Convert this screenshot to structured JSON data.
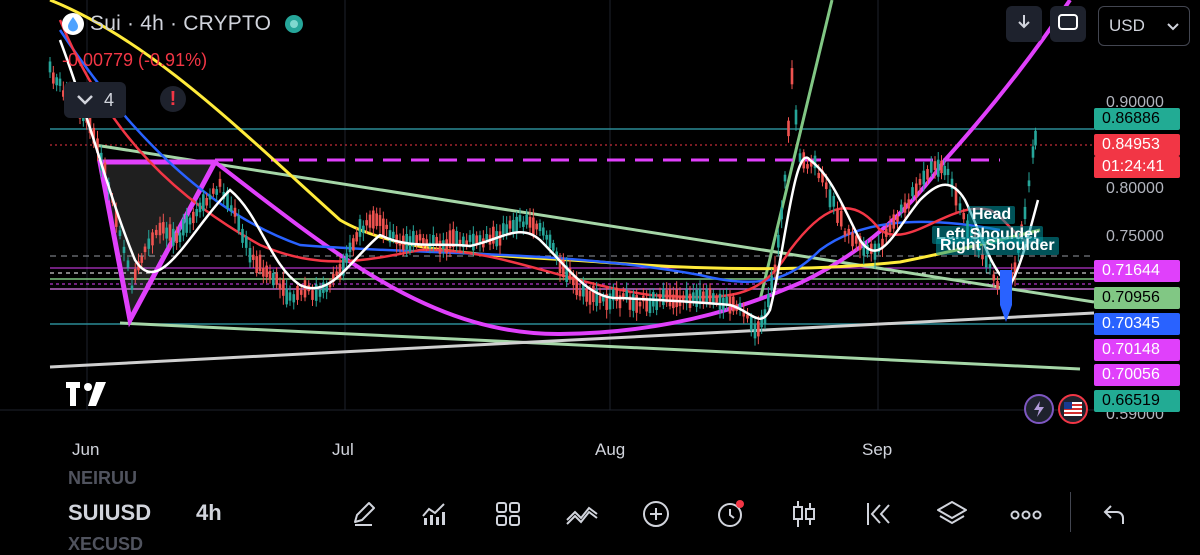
{
  "header": {
    "title": "Sui · 4h · CRYPTO",
    "change": "-0.00779 (-0.91%)",
    "indicators_count": "4",
    "warning": "!"
  },
  "toolbar": {
    "currency": "USD"
  },
  "price_axis": {
    "ticks": [
      "0.90000",
      "0.80000",
      "0.75000",
      "0.59000"
    ],
    "labels": [
      {
        "text": "0.86886",
        "color": "#22ab94"
      },
      {
        "text": "0.84953",
        "color": "#f23645"
      },
      {
        "text": "01:24:41",
        "color": "#f23645"
      },
      {
        "text": "0.71644",
        "color": "#e040fb"
      },
      {
        "text": "0.70956",
        "color": "#81c784"
      },
      {
        "text": "0.70345",
        "color": "#2962ff"
      },
      {
        "text": "0.70148",
        "color": "#e040fb"
      },
      {
        "text": "0.70056",
        "color": "#e040fb"
      },
      {
        "text": "0.66519",
        "color": "#22ab94"
      }
    ]
  },
  "time_axis": {
    "ticks": [
      "Jun",
      "Jul",
      "Aug",
      "Sep"
    ]
  },
  "annotations": {
    "head": "Head",
    "left_shoulder": "Left Shoulder",
    "right_shoulder": "Right Shoulder"
  },
  "bottom": {
    "prev_symbol": "NEIRUU",
    "symbol": "SUIUSD",
    "timeframe": "4h",
    "next_symbol": "XECUSD"
  },
  "icons": [
    "sui-logo-icon",
    "chevron-down-icon",
    "warning-icon",
    "download-icon",
    "fullscreen-icon",
    "tradingview-logo-icon",
    "lightning-icon",
    "us-flag-icon",
    "pencil-icon",
    "indicators-icon",
    "layout-grid-icon",
    "drawing-trend-icon",
    "plus-icon",
    "alert-clock-icon",
    "candles-icon",
    "replay-icon",
    "layers-icon",
    "more-icon",
    "undo-icon"
  ]
}
